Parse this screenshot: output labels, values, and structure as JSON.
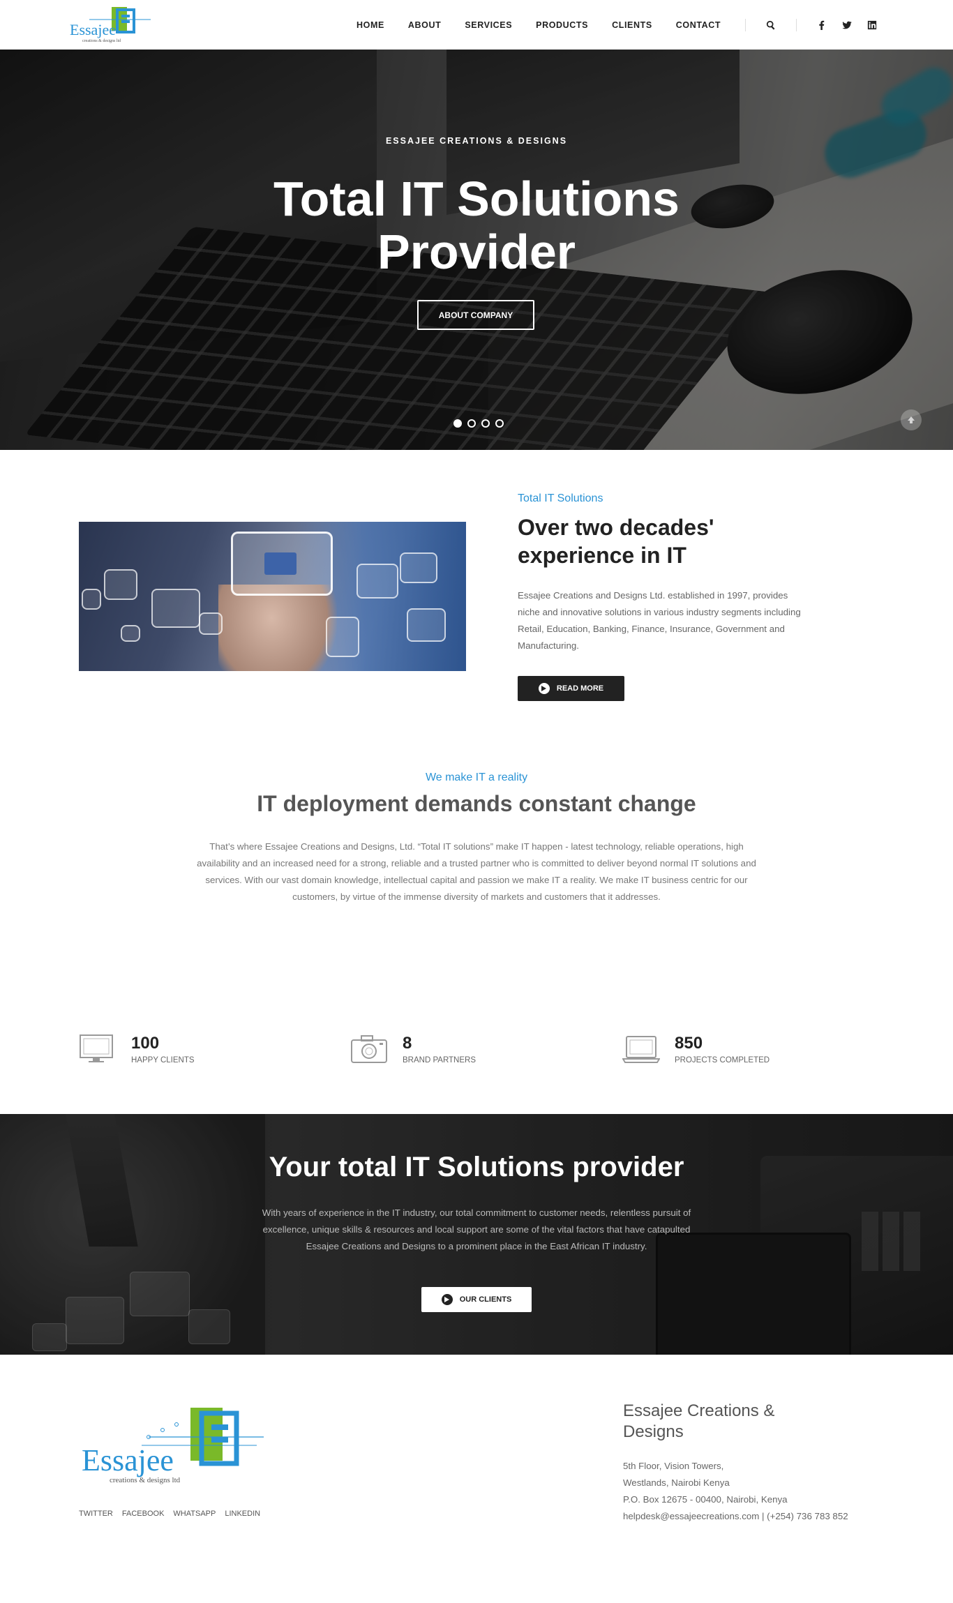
{
  "header": {
    "logo_text": "Essajee",
    "logo_subtext": "creations & designs ltd",
    "nav": [
      "HOME",
      "ABOUT",
      "SERVICES",
      "PRODUCTS",
      "CLIENTS",
      "CONTACT"
    ],
    "icons": [
      "search-icon",
      "facebook-icon",
      "twitter-icon",
      "linkedin-icon"
    ]
  },
  "hero": {
    "kicker": "ESSAJEE CREATIONS & DESIGNS",
    "title": "Total IT Solutions Provider",
    "button": "ABOUT COMPANY",
    "slides": 4,
    "active_slide": 1
  },
  "about": {
    "kicker": "Total IT Solutions",
    "title": "Over two decades' experience in IT",
    "text": "Essajee Creations and Designs Ltd. established in 1997, provides niche and innovative solutions in various industry segments including Retail, Education, Banking, Finance, Insurance, Government and Manufacturing.",
    "button": "READ MORE"
  },
  "reality": {
    "kicker": "We make IT a reality",
    "title": "IT deployment demands constant change",
    "text": "That’s where Essajee Creations and Designs, Ltd. “Total IT solutions” make IT happen - latest technology, reliable operations, high availability and an increased need for a strong, reliable and a trusted partner who is committed to deliver beyond normal IT solutions and services. With our vast domain knowledge, intellectual capital and passion we make IT a reality. We make IT business centric for our customers, by virtue of the immense diversity of markets and customers that it addresses."
  },
  "stats": [
    {
      "value": "100",
      "label": "HAPPY CLIENTS",
      "icon": "monitor-icon"
    },
    {
      "value": "8",
      "label": "BRAND PARTNERS",
      "icon": "camera-icon"
    },
    {
      "value": "850",
      "label": "PROJECTS COMPLETED",
      "icon": "laptop-icon"
    }
  ],
  "provider": {
    "title": "Your total IT Solutions provider",
    "text": "With years of experience in the IT industry, our total commitment to customer needs, relentless pursuit of excellence, unique skills & resources and local support are some of the vital factors that have catapulted Essajee Creations and Designs to a prominent place in the East African IT industry.",
    "button": "OUR CLIENTS"
  },
  "footer": {
    "logo_text": "Essajee",
    "logo_subtext": "creations & designs ltd",
    "links": [
      "TWITTER",
      "FACEBOOK",
      "WHATSAPP",
      "LINKEDIN"
    ],
    "contact_title": "Essajee Creations & Designs",
    "address_1": "5th Floor, Vision Towers,",
    "address_2": "Westlands, Nairobi Kenya",
    "address_3": "P.O. Box 12675 - 00400, Nairobi, Kenya",
    "address_4": "helpdesk@essajeecreations.com | (+254) 736 783 852"
  },
  "colors": {
    "accent": "#2a93d5",
    "logo_green": "#7ab929",
    "logo_blue": "#2a93d5",
    "dark": "#222222"
  }
}
